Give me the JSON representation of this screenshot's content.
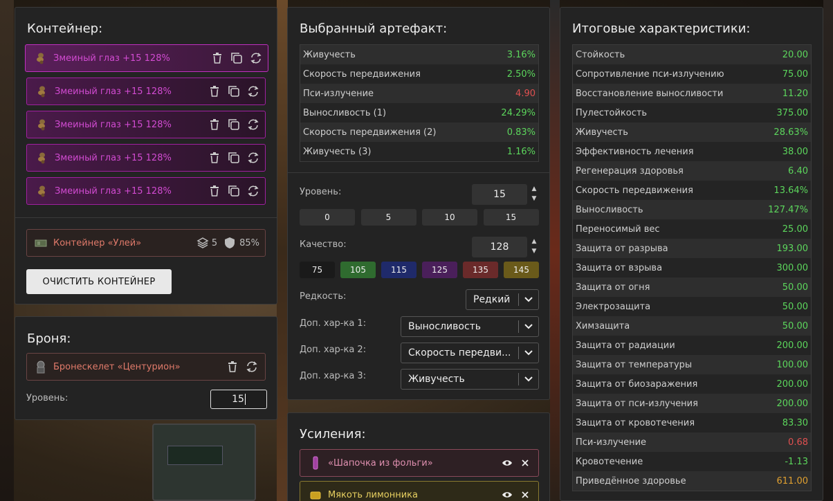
{
  "container": {
    "title": "Контейнер:",
    "slots": [
      {
        "label": "Змеиный глаз +15 128%"
      },
      {
        "label": "Змеиный глаз +15 128%"
      },
      {
        "label": "Змеиный глаз +15 128%"
      },
      {
        "label": "Змеиный глаз +15 128%"
      },
      {
        "label": "Змеиный глаз +15 128%"
      }
    ],
    "item": {
      "name": "Контейнер «Улей»",
      "capacity": "5",
      "protection": "85%"
    },
    "clear_button": "ОЧИСТИТЬ КОНТЕЙНЕР"
  },
  "armor": {
    "title": "Броня:",
    "item_name": "Бронескелет «Центурион»",
    "level_label": "Уровень:",
    "level_value": "15"
  },
  "artifact": {
    "title": "Выбранный артефакт:",
    "stats": [
      {
        "name": "Живучесть",
        "value": "3.16%",
        "color": "green"
      },
      {
        "name": "Скорость передвижения",
        "value": "2.50%",
        "color": "green"
      },
      {
        "name": "Пси-излучение",
        "value": "4.90",
        "color": "red"
      },
      {
        "name": "Выносливость (1)",
        "value": "24.29%",
        "color": "green"
      },
      {
        "name": "Скорость передвижения (2)",
        "value": "0.83%",
        "color": "green"
      },
      {
        "name": "Живучесть (3)",
        "value": "1.16%",
        "color": "green"
      }
    ],
    "level_label": "Уровень:",
    "level_value": "15",
    "level_presets": [
      "0",
      "5",
      "10",
      "15"
    ],
    "quality_label": "Качество:",
    "quality_value": "128",
    "quality_presets": [
      {
        "label": "75",
        "color": "#1a1a1a"
      },
      {
        "label": "105",
        "color": "#2f6b2f"
      },
      {
        "label": "115",
        "color": "#1f2a6a"
      },
      {
        "label": "125",
        "color": "#4a1f5a"
      },
      {
        "label": "135",
        "color": "#6a2a2a"
      },
      {
        "label": "145",
        "color": "#6a5a1a"
      }
    ],
    "rarity_label": "Редкость:",
    "rarity_value": "Редкий",
    "extra1_label": "Доп. хар-ка 1:",
    "extra1_value": "Выносливость",
    "extra2_label": "Доп. хар-ка 2:",
    "extra2_value": "Скорость передви...",
    "extra3_label": "Доп. хар-ка 3:",
    "extra3_value": "Живучесть"
  },
  "boosts": {
    "title": "Усиления:",
    "items": [
      {
        "name": "«Шапочка из фольги»"
      },
      {
        "name": "Мякоть лимонника"
      }
    ]
  },
  "totals": {
    "title": "Итоговые характеристики:",
    "stats": [
      {
        "name": "Стойкость",
        "value": "20.00",
        "color": "green"
      },
      {
        "name": "Сопротивление пси-излучению",
        "value": "75.00",
        "color": "green"
      },
      {
        "name": "Восстановление выносливости",
        "value": "11.20",
        "color": "green"
      },
      {
        "name": "Пулестойкость",
        "value": "375.00",
        "color": "green"
      },
      {
        "name": "Живучесть",
        "value": "28.63%",
        "color": "green"
      },
      {
        "name": "Эффективность лечения",
        "value": "38.00",
        "color": "green"
      },
      {
        "name": "Регенерация здоровья",
        "value": "6.40",
        "color": "green"
      },
      {
        "name": "Скорость передвижения",
        "value": "13.64%",
        "color": "green"
      },
      {
        "name": "Выносливость",
        "value": "127.47%",
        "color": "green"
      },
      {
        "name": "Переносимый вес",
        "value": "25.00",
        "color": "green"
      },
      {
        "name": "Защита от разрыва",
        "value": "193.00",
        "color": "green"
      },
      {
        "name": "Защита от взрыва",
        "value": "300.00",
        "color": "green"
      },
      {
        "name": "Защита от огня",
        "value": "50.00",
        "color": "green"
      },
      {
        "name": "Электрозащита",
        "value": "50.00",
        "color": "green"
      },
      {
        "name": "Химзащита",
        "value": "50.00",
        "color": "green"
      },
      {
        "name": "Защита от радиации",
        "value": "200.00",
        "color": "green"
      },
      {
        "name": "Защита от температуры",
        "value": "100.00",
        "color": "green"
      },
      {
        "name": "Защита от биозаражения",
        "value": "200.00",
        "color": "green"
      },
      {
        "name": "Защита от пси-излучения",
        "value": "200.00",
        "color": "green"
      },
      {
        "name": "Защита от кровотечения",
        "value": "83.30",
        "color": "green"
      },
      {
        "name": "Пси-излучение",
        "value": "0.68",
        "color": "red"
      },
      {
        "name": "Кровотечение",
        "value": "-1.13",
        "color": "green"
      },
      {
        "name": "Приведённое здоровье",
        "value": "611.00",
        "color": "orange"
      }
    ]
  }
}
